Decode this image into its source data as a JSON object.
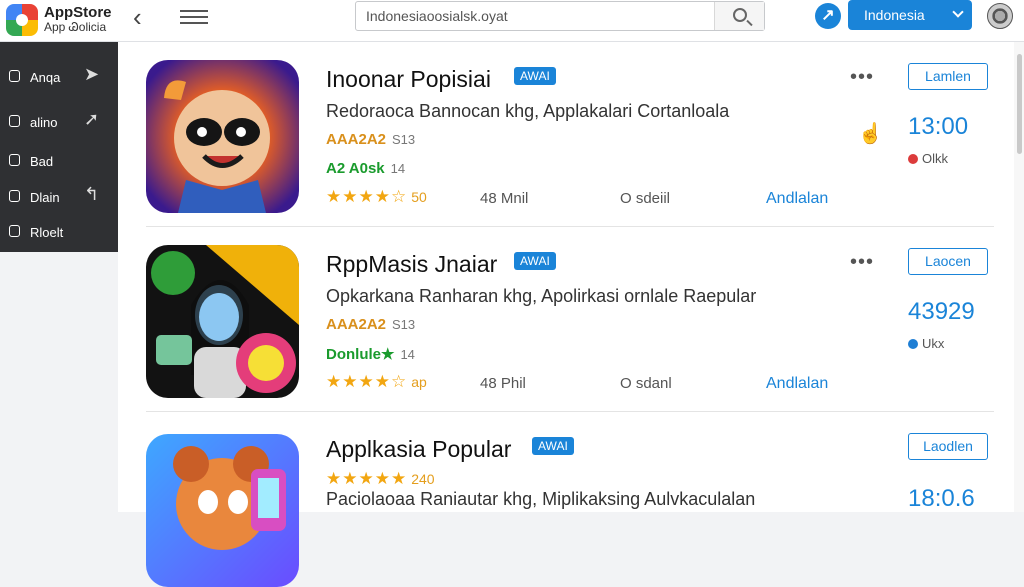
{
  "header": {
    "brand_title": "AppStore",
    "brand_subtitle": "App Ꮚolicia",
    "search_value": "Indonesiaoosialsk.oyat",
    "language_label": "Indonesia"
  },
  "sidebar": {
    "items": [
      {
        "label": "Anqa",
        "icon": "pin-icon"
      },
      {
        "label": "alino",
        "icon": "chat-icon"
      },
      {
        "label": "Bad",
        "icon": "bag-icon"
      },
      {
        "label": "Dlain",
        "icon": "clip-icon"
      },
      {
        "label": "Rloelt",
        "icon": "doc-icon"
      }
    ]
  },
  "apps": [
    {
      "title": "Inoonar Popisiai",
      "badge": "AWAI",
      "description": "Redoraoca Bannocan khg, Applakalari Cortanloala",
      "code": "AAA2A2",
      "code_count": "S13",
      "tag": "A2 A0sk",
      "tag_count": "14",
      "stars": "★★★★☆",
      "rating_count": "50",
      "size_text": "48 Mnil",
      "version": "O sdeiil",
      "detail_link": "Andlalan",
      "install_label": "Lamlen",
      "download_count": "13:00",
      "download_label": "Olkk",
      "download_dot_color": "#dc3b3b"
    },
    {
      "title": "RppMasis Jnaiar",
      "badge": "AWAI",
      "description": "Opkarkana Ranharan khg, Apolirkasi ornlale Raepular",
      "code": "AAA2A2",
      "code_count": "S13",
      "tag": "Donlule★",
      "tag_count": "14",
      "stars": "★★★★☆",
      "rating_count": "ap",
      "size_text": "48 Phil",
      "version": "O sdanl",
      "detail_link": "Andlalan",
      "install_label": "Laocen",
      "download_count": "43929",
      "download_label": "Ukx",
      "download_dot_color": "#1e7ed4"
    },
    {
      "title": "Applkasia Popular",
      "badge": "AWAI",
      "description": "Paciolaoaa Raniautar khg, Miplikaksing Aulvkaculalan",
      "code": "",
      "code_count": "",
      "tag": "",
      "tag_count": "",
      "stars": "★★★★★",
      "rating_count": "240",
      "size_text": "",
      "version": "",
      "detail_link": "",
      "install_label": "Laodlen",
      "download_count": "18:0.6",
      "download_label": "",
      "download_dot_color": "#1e7ed4"
    }
  ],
  "colors": {
    "accent": "#1a84d8",
    "sidebar_bg": "#2f3033",
    "star": "#f2a611"
  }
}
